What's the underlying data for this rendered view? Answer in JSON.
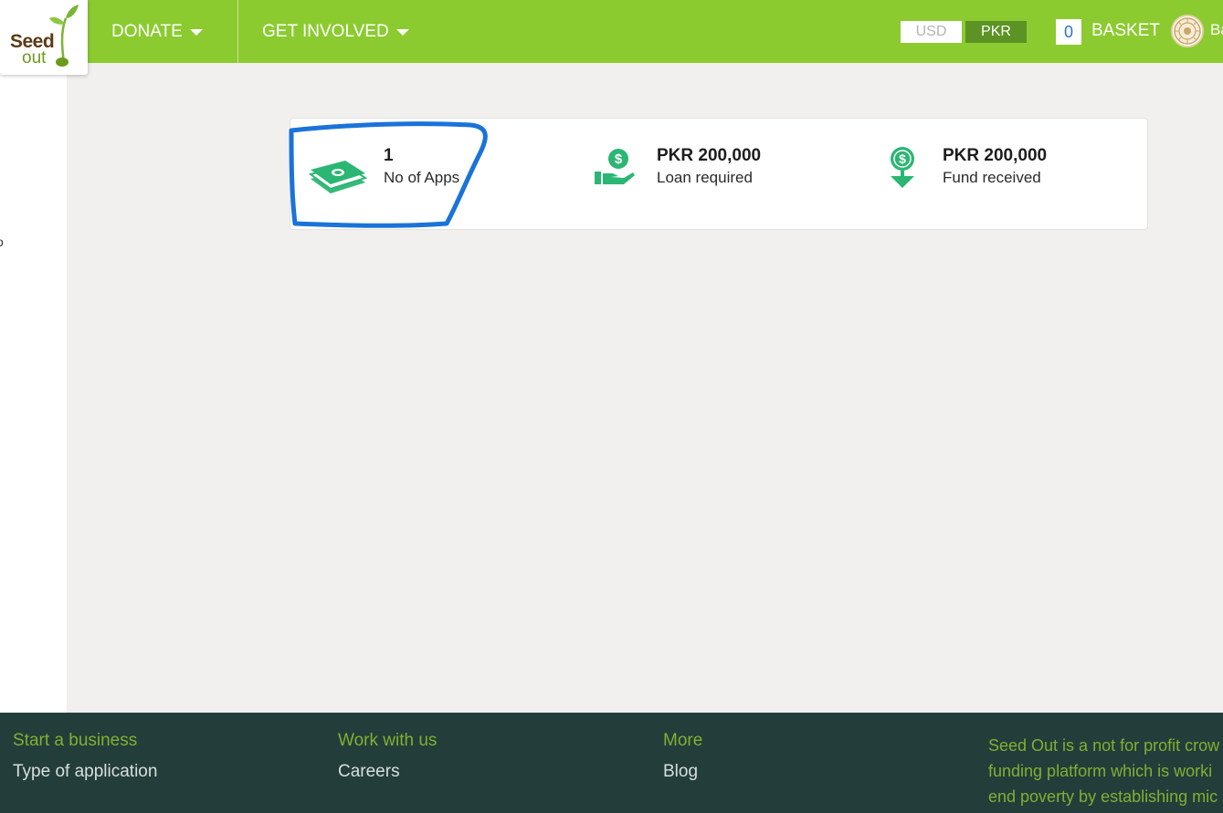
{
  "header": {
    "logo": {
      "text_top": "Seed",
      "text_bottom": "out"
    },
    "nav": {
      "donate": "DONATE",
      "get_involved": "GET INVOLVED"
    },
    "currency": {
      "usd": "USD",
      "pkr": "PKR",
      "selected": "PKR"
    },
    "basket": {
      "count": "0",
      "label": "BASKET"
    },
    "user": {
      "name_fragment": "Ba"
    }
  },
  "sidebar": {
    "fragment": "o"
  },
  "stats": [
    {
      "value": "1",
      "label": "No of Apps",
      "icon": "money-stack-icon"
    },
    {
      "value": "PKR 200,000",
      "label": "Loan required",
      "icon": "hand-dollar-icon"
    },
    {
      "value": "PKR 200,000",
      "label": "Fund received",
      "icon": "dollar-pin-icon"
    }
  ],
  "footer": {
    "col1": {
      "heading": "Start a business",
      "link": "Type of application"
    },
    "col2": {
      "heading": "Work with us",
      "link": "Careers"
    },
    "col3": {
      "heading": "More",
      "link": "Blog"
    },
    "about": [
      "Seed Out is a not for profit crow",
      "funding platform which is worki",
      "end poverty by establishing mic"
    ]
  },
  "colors": {
    "brand_green": "#8bcb30",
    "dark_green": "#5b9324",
    "footer_bg": "#233e3a",
    "icon_green": "#2bb673",
    "highlight_blue": "#1a73d9"
  }
}
